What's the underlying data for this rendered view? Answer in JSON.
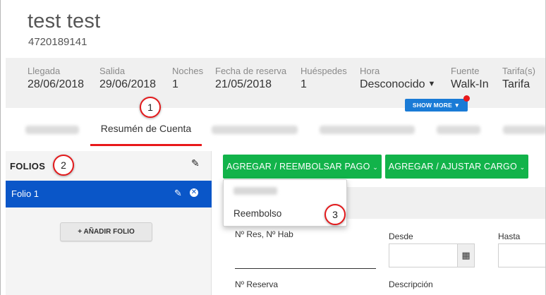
{
  "guest": {
    "name": "test test",
    "phone": "4720189141"
  },
  "info": [
    {
      "label": "Llegada",
      "value": "28/06/2018"
    },
    {
      "label": "Salida",
      "value": "29/06/2018"
    },
    {
      "label": "Noches",
      "value": "1"
    },
    {
      "label": "Fecha de reserva",
      "value": "21/05/2018"
    },
    {
      "label": "Huéspedes",
      "value": "1"
    },
    {
      "label": "Hora",
      "value": "Desconocido"
    },
    {
      "label": "Fuente",
      "value": "Walk-In"
    },
    {
      "label": "Tarifa(s)",
      "value": "Tarifa"
    }
  ],
  "show_more": "SHOW MORE",
  "tabs": {
    "active": "Resumén de Cuenta"
  },
  "annotations": [
    "1",
    "2",
    "3"
  ],
  "folios": {
    "title": "FOLIOS",
    "items": [
      {
        "label": "Folio 1"
      }
    ],
    "add_button": "AÑADIR FOLIO"
  },
  "actions": {
    "add_refund_payment": "AGREGAR / REEMBOLSAR PAGO",
    "add_adjust_charge": "AGREGAR / AJUSTAR CARGO"
  },
  "dropdown": {
    "items": [
      "Reembolso"
    ]
  },
  "form": {
    "res_label": "Nº Res, Nº Hab",
    "desde_label": "Desde",
    "hasta_label": "Hasta",
    "reserva_label": "Nº Reserva",
    "descripcion_label": "Descripción"
  },
  "colors": {
    "primary": "#0a56c8",
    "green": "#12b34a",
    "accent_red": "#e8191b",
    "show_more_blue": "#1a7bd6"
  }
}
